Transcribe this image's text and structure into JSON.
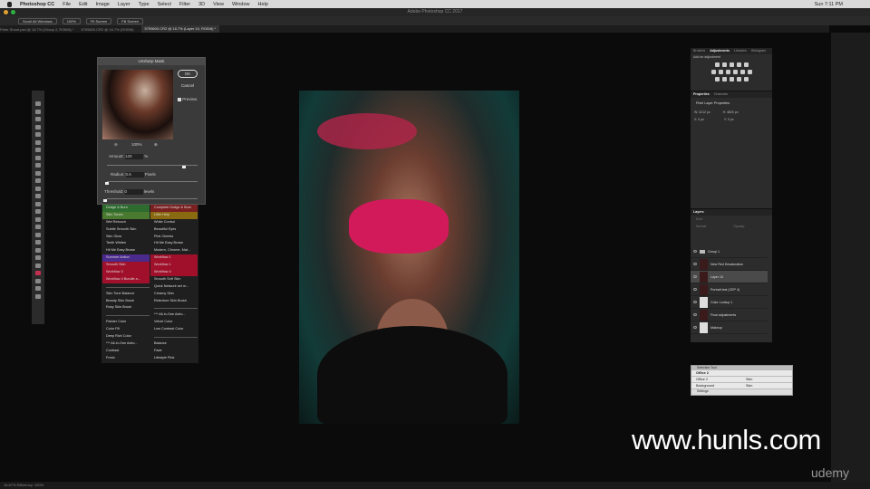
{
  "menubar": {
    "app": "Photoshop CC",
    "items": [
      "File",
      "Edit",
      "Image",
      "Layer",
      "Type",
      "Select",
      "Filter",
      "3D",
      "View",
      "Window",
      "Help"
    ],
    "clock": "Sun 7:11 PM"
  },
  "window_title": "Adobe Photoshop CC 2017",
  "options": [
    "Scroll All Windows",
    "100%",
    "Fit Screen",
    "Fill Screen"
  ],
  "tabs": [
    "Peter Shoot.psd @ 16.7% (Group 2, RGB/8) *",
    "5759600.CR2 @ 16.7% (RGB/8)",
    "5759600.CR2 @ 16.7% (Layer 10, RGB/8) *"
  ],
  "dialog": {
    "title": "Unsharp Mask",
    "ok": "OK",
    "cancel": "Cancel",
    "preview": "Preview",
    "zoom": "100%",
    "amount_label": "Amount:",
    "amount": "120",
    "amount_unit": "%",
    "radius_label": "Radius:",
    "radius": "0.5",
    "radius_unit": "Pixels",
    "threshold_label": "Threshold:",
    "threshold": "0",
    "threshold_unit": "levels"
  },
  "actions": [
    {
      "l": "Dodge & Burn",
      "r": "Complete Dodge & Burn",
      "lc": "#2e6b2e",
      "rc": "#7a2020"
    },
    {
      "l": "Skin Tones",
      "r": "Little Help",
      "lc": "#4a7a30",
      "rc": "#8a6a10"
    },
    {
      "l": "Wet Retouch",
      "r": "White Control",
      "lc": "",
      "rc": ""
    },
    {
      "l": "Subtle Smooth Skin",
      "r": "Beautiful Eyes",
      "lc": "",
      "rc": ""
    },
    {
      "l": "Skin Glow",
      "r": "Pink Cheeks",
      "lc": "",
      "rc": ""
    },
    {
      "l": "Teeth Whiten",
      "r": "Hit Me Easy Brown",
      "lc": "",
      "rc": ""
    },
    {
      "l": "Hit Me Easy Brown",
      "r": "Modern, Chrome, Mat...",
      "lc": "",
      "rc": ""
    },
    {
      "l": "Summer Action",
      "r": "Workflow 1",
      "lc": "#4a2a8a",
      "rc": "#a0102a"
    },
    {
      "l": "Smooth Skin",
      "r": "Workflow 1",
      "lc": "#a0102a",
      "rc": "#a0102a"
    },
    {
      "l": "Workflow 3",
      "r": "Workflow 4",
      "lc": "#a0102a",
      "rc": "#a0102a"
    },
    {
      "l": "Workflow 4 Bundle a...",
      "r": "Smooth Soft Skin",
      "lc": "#a0102a",
      "rc": ""
    },
    {
      "l": "",
      "r": "Quick Network set m...",
      "lc": "",
      "rc": ""
    },
    {
      "l": "Skin Tone Balance",
      "r": "Creamy Skin",
      "lc": "",
      "rc": ""
    },
    {
      "l": "Beauty Skin Brush",
      "r": "Retexture Skin Brush",
      "lc": "",
      "rc": ""
    },
    {
      "l": "Rosy Skin Brush",
      "r": "",
      "lc": "",
      "rc": ""
    },
    {
      "l": "",
      "r": "*** All-in-One Actio...",
      "lc": "",
      "rc": ""
    },
    {
      "l": "Painter Color",
      "r": "Velvet Color",
      "lc": "",
      "rc": ""
    },
    {
      "l": "Color Fill",
      "r": "Low Contrast Color",
      "lc": "",
      "rc": ""
    },
    {
      "l": "Deep Rich Color",
      "r": "",
      "lc": "",
      "rc": ""
    },
    {
      "l": "*** All-in-One Actio...",
      "r": "Balance",
      "lc": "",
      "rc": ""
    },
    {
      "l": "Contrast",
      "r": "Fade",
      "lc": "",
      "rc": ""
    },
    {
      "l": "Fresh",
      "r": "Lifestyle Pink",
      "lc": "",
      "rc": ""
    }
  ],
  "adjustments": {
    "tabs": [
      "Brushes",
      "Adjustments",
      "Libraries",
      "Histogram"
    ],
    "active": 1,
    "subtitle": "Add an adjustment"
  },
  "properties": {
    "tabs": [
      "Properties",
      "Channels"
    ],
    "title": "Pixel Layer Properties",
    "w": "W: 3212 px",
    "h": "H: 4820 px",
    "x": "X: 0 px",
    "y": "Y: 0 px"
  },
  "layers": {
    "title": "Layers",
    "kind": "Kind",
    "mode": "Normal",
    "opacity": "Opacity:",
    "items": [
      {
        "name": "Group 1",
        "type": "group"
      },
      {
        "name": "New Red Desaturation",
        "type": "photo"
      },
      {
        "name": "Layer 10",
        "type": "photo",
        "selected": true
      },
      {
        "name": "Portrait test (CEP 4)",
        "type": "photo"
      },
      {
        "name": "Color Lookup 1",
        "type": "adj"
      },
      {
        "name": "Final adjustments",
        "type": "photo"
      },
      {
        "name": "Makeup",
        "type": "adj"
      }
    ]
  },
  "panel2": {
    "title": "Selection Tool",
    "header": "Office 2",
    "rows": [
      [
        "Office 2",
        "Skin"
      ],
      [
        "Background",
        "Skin"
      ]
    ],
    "footer": "Settings"
  },
  "watermark": "www.hunls.com",
  "udemy": "udemy",
  "status": "16.67%   Efficiency: 100%"
}
